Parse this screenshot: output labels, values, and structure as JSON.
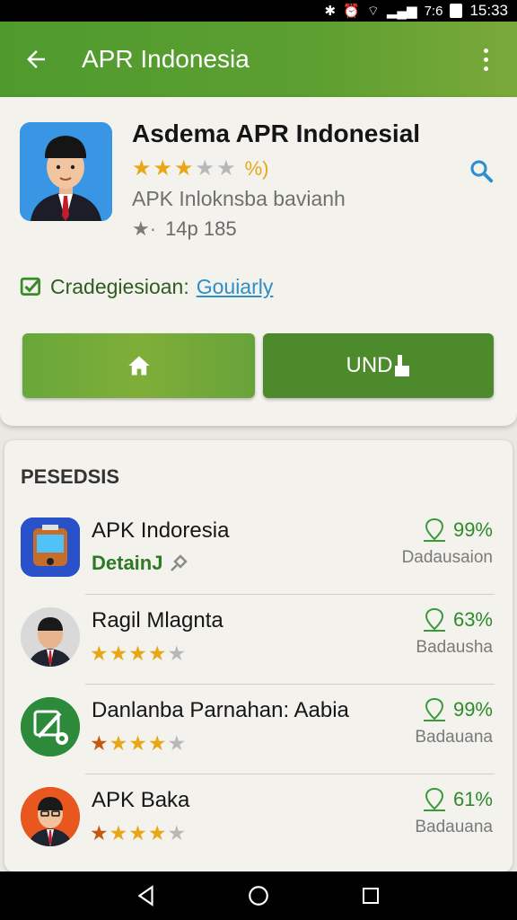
{
  "status_bar": {
    "icons_text": "7:6",
    "time": "15:33"
  },
  "app_bar": {
    "title": "APR Indonesia",
    "back_icon": "arrow-left-icon",
    "menu_icon": "more-vert-icon"
  },
  "app": {
    "name": "Asdema APR Indonesial",
    "rating": {
      "stars": 3,
      "max": 5,
      "label": "%)"
    },
    "subtitle": "APK Inloknsba bavianh",
    "meta": "14p 185",
    "category_label": "Cradegiesioan:",
    "category_link": "Gouiarly"
  },
  "buttons": {
    "home_icon": "home-icon",
    "install_label": "UND"
  },
  "list": {
    "section_title": "PESEDSIS",
    "items": [
      {
        "name": "APK Indoresia",
        "detail": "DetainJ",
        "pct": "99%",
        "sub": "Dadausaion",
        "stars": null
      },
      {
        "name": "Ragil Mlagnta",
        "detail": null,
        "pct": "63%",
        "sub": "Badausha",
        "stars": 4
      },
      {
        "name": "Danlanba Parnahan: Aabia",
        "detail": null,
        "pct": "99%",
        "sub": "Badauana",
        "stars": 4
      },
      {
        "name": "APK Baka",
        "detail": null,
        "pct": "61%",
        "sub": "Badauana",
        "stars": 4
      }
    ]
  },
  "colors": {
    "accent_green": "#5a9d2f",
    "button_dark": "#4c8a2b",
    "link_blue": "#2e8ec8",
    "star": "#e7a717"
  }
}
